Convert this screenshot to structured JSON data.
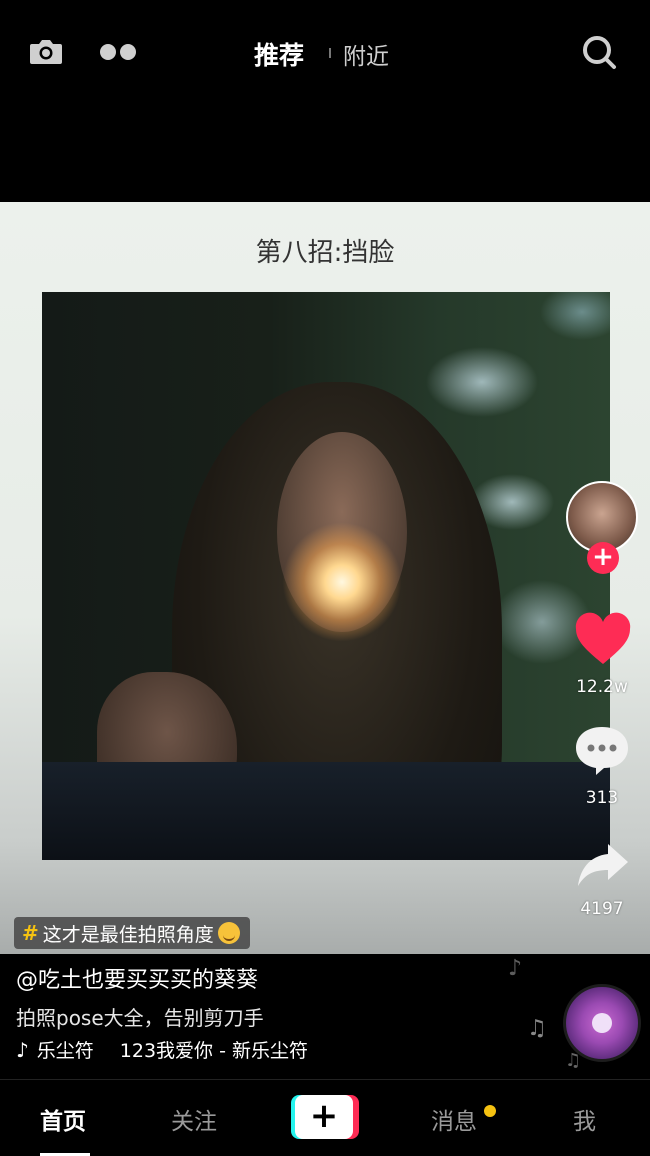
{
  "header": {
    "tab_recommend": "推荐",
    "tab_nearby": "附近"
  },
  "card": {
    "title": "第八招:挡脸",
    "hashtag": "这才是最佳拍照角度"
  },
  "rail": {
    "follow_label": "+",
    "like_count": "12.2w",
    "comment_count": "313",
    "share_count": "4197"
  },
  "info": {
    "author": "@吃土也要买买买的葵葵",
    "description": "拍照pose大全，告别剪刀手",
    "music_text_a": "乐尘符",
    "music_text_b": "123我爱你 - 新乐尘符"
  },
  "nav": {
    "home": "首页",
    "follow": "关注",
    "add": "+",
    "messages": "消息",
    "me": "我"
  },
  "colors": {
    "accent_red": "#fe2c55",
    "accent_cyan": "#25f4ee",
    "hashtag_yellow": "#f5c211",
    "background": "#000000"
  },
  "icons": [
    "camera-icon",
    "dots-icon",
    "search-icon",
    "heart-icon",
    "comment-icon",
    "share-icon",
    "music-note-icon",
    "music-disc-icon"
  ]
}
